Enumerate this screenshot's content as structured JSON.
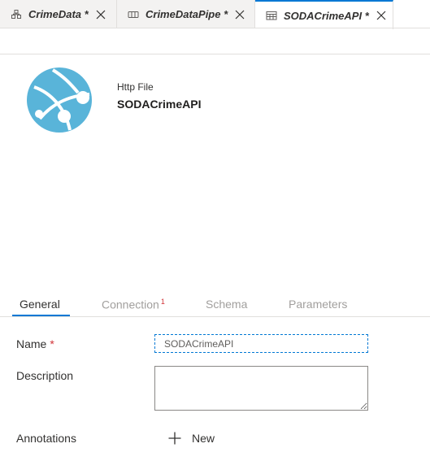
{
  "tabs": [
    {
      "label": "CrimeData *",
      "icon": "dataflow-icon"
    },
    {
      "label": "CrimeDataPipe *",
      "icon": "pipeline-icon"
    },
    {
      "label": "SODACrimeAPI *",
      "icon": "dataset-table-icon",
      "active": true
    }
  ],
  "header": {
    "type_label": "Http File",
    "dataset_name": "SODACrimeAPI",
    "logo_icon": "http-globe-icon",
    "logo_color": "#59b4d9"
  },
  "property_tabs": {
    "general": "General",
    "connection": "Connection",
    "connection_badge": "1",
    "schema": "Schema",
    "parameters": "Parameters"
  },
  "form": {
    "name_label": "Name",
    "required_mark": "*",
    "name_value": "SODACrimeAPI",
    "description_label": "Description",
    "description_value": "",
    "annotations_label": "Annotations",
    "new_button_label": "New"
  },
  "colors": {
    "accent": "#0078d4",
    "required": "#d13438"
  }
}
